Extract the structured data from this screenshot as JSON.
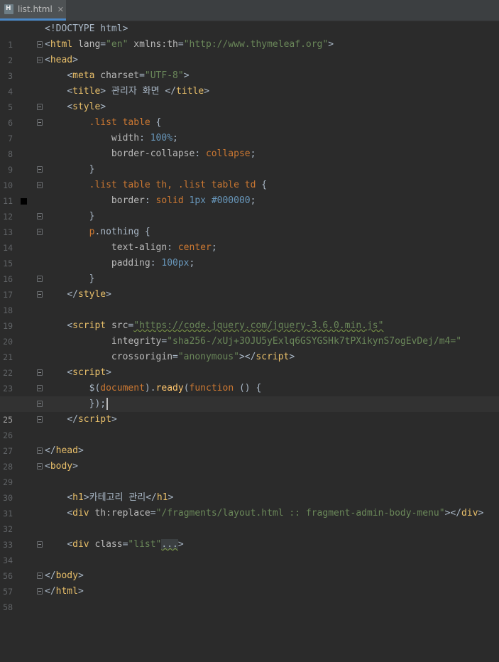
{
  "tab": {
    "filename": "list.html",
    "close": "✕"
  },
  "lines": [
    {
      "n": "1"
    },
    {
      "n": "2"
    },
    {
      "n": "3"
    },
    {
      "n": "4"
    },
    {
      "n": "5"
    },
    {
      "n": "6"
    },
    {
      "n": "7"
    },
    {
      "n": "8"
    },
    {
      "n": "9"
    },
    {
      "n": "10"
    },
    {
      "n": "11"
    },
    {
      "n": "12"
    },
    {
      "n": "13"
    },
    {
      "n": "14"
    },
    {
      "n": "15"
    },
    {
      "n": "16"
    },
    {
      "n": "17"
    },
    {
      "n": "18"
    },
    {
      "n": "19"
    },
    {
      "n": "20"
    },
    {
      "n": "21"
    },
    {
      "n": "22"
    },
    {
      "n": "23"
    },
    {
      "n": "24"
    },
    {
      "n": "25"
    },
    {
      "n": "26"
    },
    {
      "n": "27"
    },
    {
      "n": "28"
    },
    {
      "n": "29"
    },
    {
      "n": "30"
    },
    {
      "n": "31"
    },
    {
      "n": "32"
    },
    {
      "n": "33"
    },
    {
      "n": "34"
    },
    {
      "n": "56"
    },
    {
      "n": "57"
    },
    {
      "n": "58"
    }
  ],
  "code": {
    "l1": "<!DOCTYPE html>",
    "l2_tag": "html",
    "l2_a1": "lang",
    "l2_v1": "\"en\"",
    "l2_a2": "xmlns:th",
    "l2_v2": "\"http://www.thymeleaf.org\"",
    "l3": "head",
    "l4_tag": "meta",
    "l4_a": "charset",
    "l4_v": "\"UTF-8\"",
    "l5_tag": "title",
    "l5_text": " 관리자 화면 ",
    "l6": "style",
    "l7_sel": ".list table",
    "l8_prop": "width",
    "l8_val": "100%",
    "l9_prop": "border-collapse",
    "l9_val": "collapse",
    "l11_sel": ".list table th, .list table td",
    "l12_prop": "border",
    "l12_val1": "solid",
    "l12_val2": "1px",
    "l12_val3": "#000000",
    "l14_sel_tag": "p",
    "l14_sel_cls": ".nothing",
    "l15_prop": "text-align",
    "l15_val": "center",
    "l16_prop": "padding",
    "l16_val": "100px",
    "l18": "style",
    "l20_tag": "script",
    "l20_a": "src",
    "l20_v": "\"https://code.jquery.com/jquery-3.6.0.min.js\"",
    "l21_a": "integrity",
    "l21_v": "\"sha256-/xUj+3OJU5yExlq6GSYGSHk7tPXikynS7ogEvDej/m4=\"",
    "l22_a": "crossorigin",
    "l22_v": "\"anonymous\"",
    "l22_tag": "script",
    "l23_tag": "script",
    "l24_dollar": "$",
    "l24_doc": "document",
    "l24_ready": "ready",
    "l24_fn": "function",
    "l25": "});",
    "l26_tag": "script",
    "l28_tag": "head",
    "l29_tag": "body",
    "l31_tag": "h1",
    "l31_text": "카테고리 관리",
    "l32_tag": "div",
    "l32_a": "th:replace",
    "l32_v": "\"/fragments/layout.html :: fragment-admin-body-menu\"",
    "l34_tag": "div",
    "l34_a": "class",
    "l34_v": "\"list\"",
    "l34_dots": "...",
    "l57_tag": "body",
    "l58_tag": "html"
  }
}
